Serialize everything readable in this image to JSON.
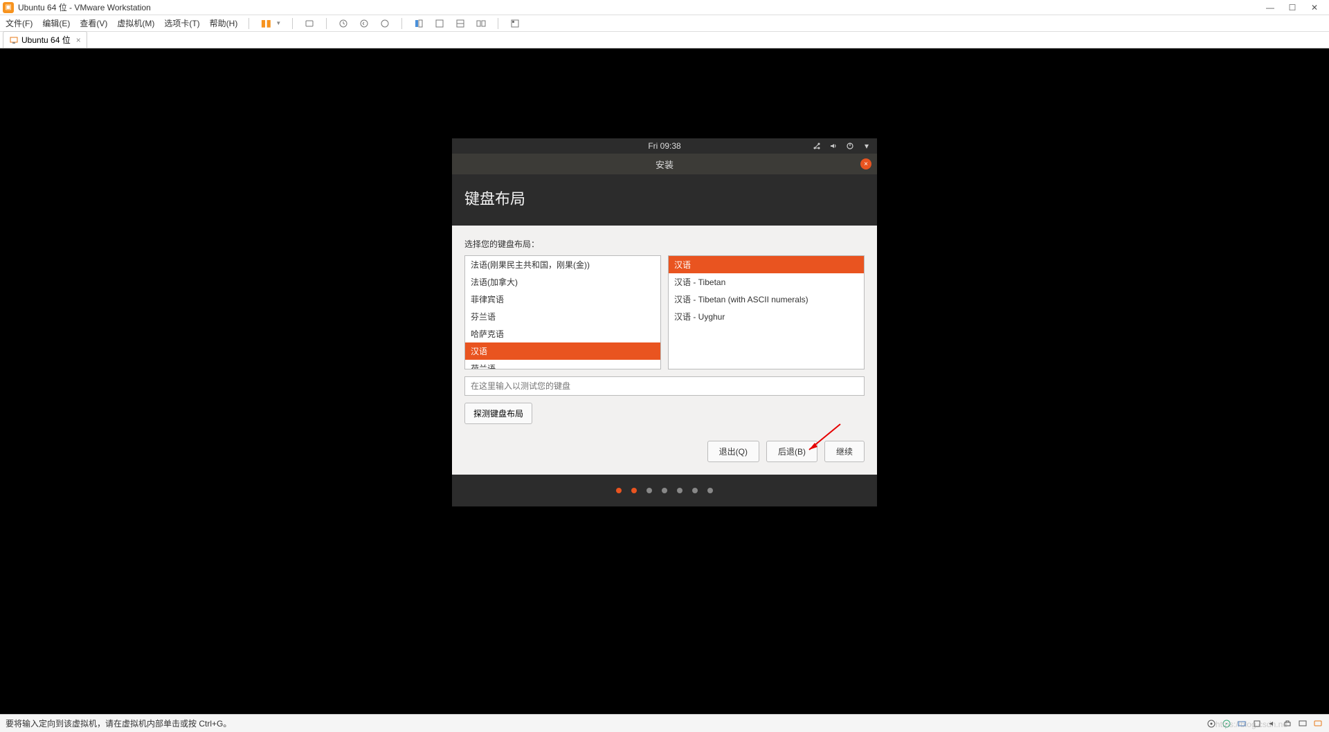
{
  "vmware": {
    "title": "Ubuntu 64 位 - VMware Workstation",
    "menus": [
      "文件(F)",
      "编辑(E)",
      "查看(V)",
      "虚拟机(M)",
      "选项卡(T)",
      "帮助(H)"
    ],
    "tab_label": "Ubuntu 64 位",
    "status_text": "要将输入定向到该虚拟机，请在虚拟机内部单击或按 Ctrl+G。"
  },
  "ubuntu": {
    "clock": "Fri 09:38",
    "installer_title": "安装",
    "heading": "键盘布局",
    "prompt": "选择您的键盘布局：",
    "left_list": [
      "法语(刚果民主共和国，刚果(金))",
      "法语(加拿大)",
      "菲律宾语",
      "芬兰语",
      "哈萨克语",
      "汉语",
      "荷兰语"
    ],
    "left_selected_index": 5,
    "right_list": [
      "汉语",
      "汉语 - Tibetan",
      "汉语 - Tibetan (with ASCII numerals)",
      "汉语 - Uyghur"
    ],
    "right_selected_index": 0,
    "test_placeholder": "在这里输入以测试您的键盘",
    "detect_button": "探测键盘布局",
    "quit_button": "退出(Q)",
    "back_button": "后退(B)",
    "continue_button": "继续",
    "active_dots": [
      0,
      1
    ]
  },
  "watermark": "https://blog.csdn.ne"
}
